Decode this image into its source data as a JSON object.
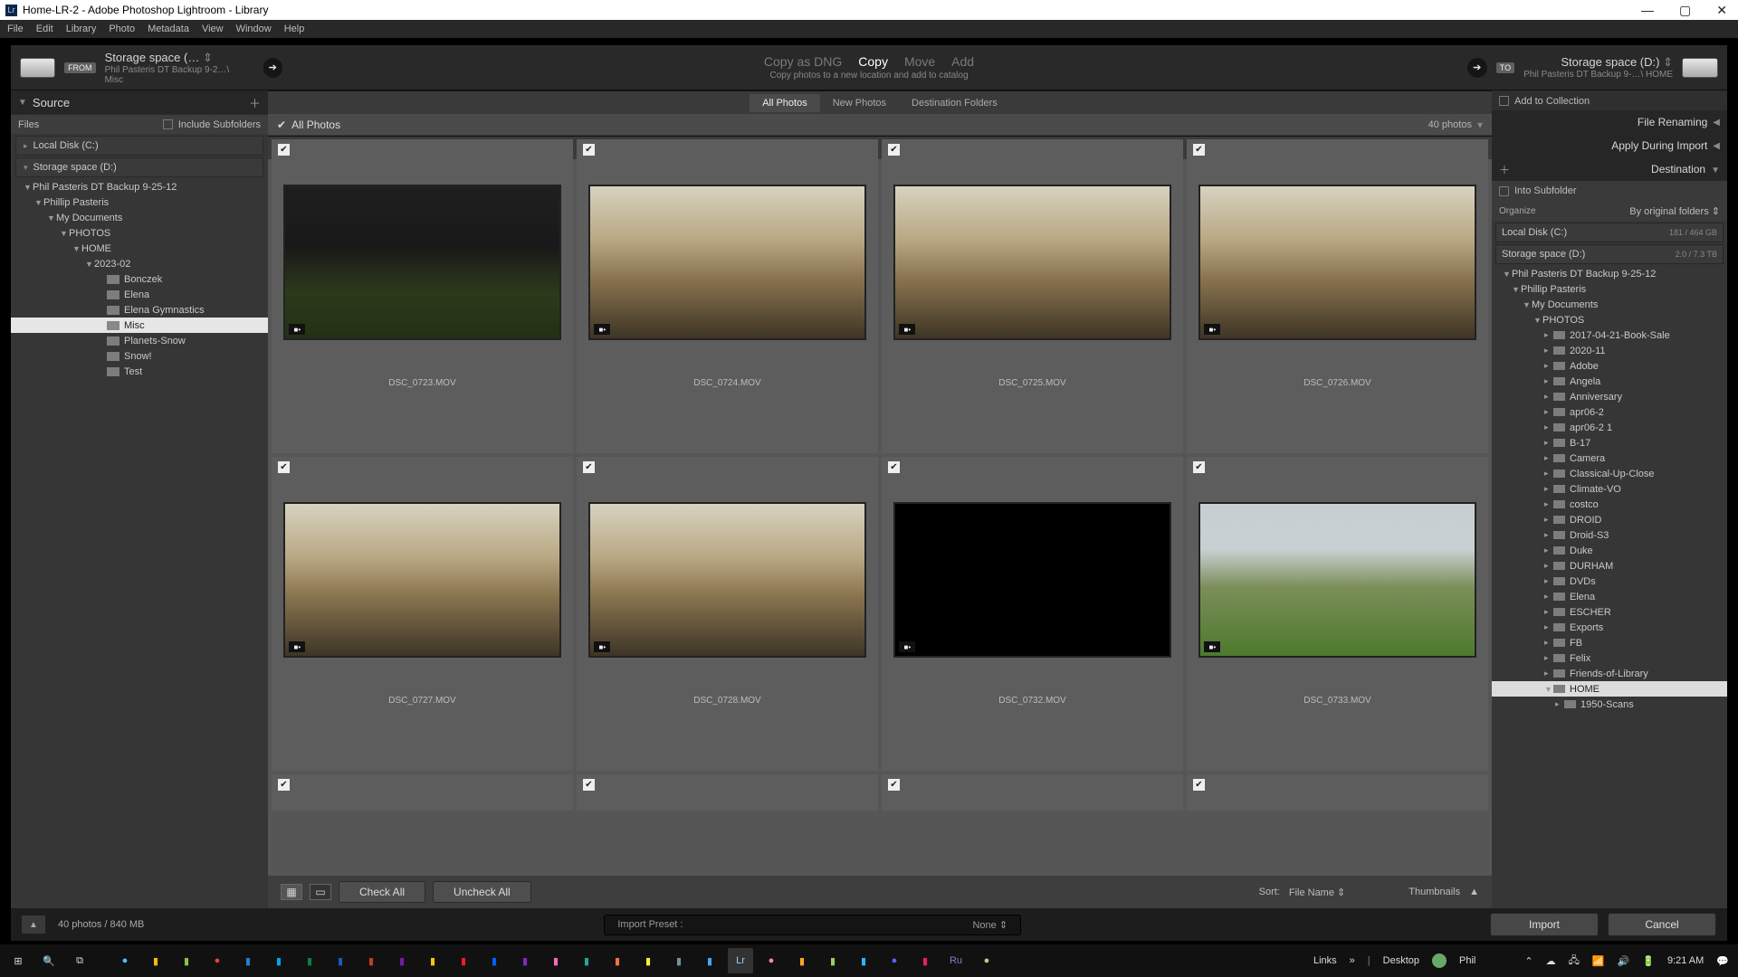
{
  "window": {
    "title": "Home-LR-2 - Adobe Photoshop Lightroom - Library"
  },
  "menu": [
    "File",
    "Edit",
    "Library",
    "Photo",
    "Metadata",
    "View",
    "Window",
    "Help"
  ],
  "import_top": {
    "from_badge": "FROM",
    "from_title": "Storage space (…",
    "from_path": "Phil Pasteris DT Backup 9-2…\\ Misc",
    "modes": {
      "copy_dng": "Copy as DNG",
      "copy": "Copy",
      "move": "Move",
      "add": "Add"
    },
    "modes_sub": "Copy photos to a new location and add to catalog",
    "to_badge": "TO",
    "to_title": "Storage space (D:)",
    "to_path": "Phil Pasteris DT Backup 9-…\\ HOME",
    "add_to_collection": "Add to Collection"
  },
  "view_tabs": {
    "all": "All Photos",
    "new": "New Photos",
    "dest": "Destination Folders"
  },
  "left": {
    "header": "Source",
    "files_label": "Files",
    "include_sub": "Include Subfolders",
    "vol1": "Local Disk (C:)",
    "vol2": "Storage space (D:)",
    "tree": [
      {
        "lvl": 0,
        "exp": "▼",
        "label": "Phil Pasteris DT Backup 9-25-12"
      },
      {
        "lvl": 1,
        "exp": "▼",
        "label": "Phillip Pasteris"
      },
      {
        "lvl": 2,
        "exp": "▼",
        "label": "My Documents"
      },
      {
        "lvl": 3,
        "exp": "▼",
        "label": "PHOTOS"
      },
      {
        "lvl": 4,
        "exp": "▼",
        "label": "HOME"
      },
      {
        "lvl": 5,
        "exp": "▼",
        "label": "2023-02"
      },
      {
        "lvl": 6,
        "exp": "",
        "label": "Bonczek",
        "folder": true
      },
      {
        "lvl": 6,
        "exp": "",
        "label": "Elena",
        "folder": true
      },
      {
        "lvl": 6,
        "exp": "",
        "label": "Elena Gymnastics",
        "folder": true
      },
      {
        "lvl": 6,
        "exp": "",
        "label": "Misc",
        "folder": true,
        "sel": true
      },
      {
        "lvl": 6,
        "exp": "",
        "label": "Planets-Snow",
        "folder": true
      },
      {
        "lvl": 6,
        "exp": "",
        "label": "Snow!",
        "folder": true
      },
      {
        "lvl": 6,
        "exp": "",
        "label": "Test",
        "folder": true
      }
    ]
  },
  "grid": {
    "header_check": true,
    "header_label": "All Photos",
    "count": "40 photos",
    "items": [
      {
        "name": "DSC_0723.MOV",
        "type": "porch"
      },
      {
        "name": "DSC_0724.MOV",
        "type": "office"
      },
      {
        "name": "DSC_0725.MOV",
        "type": "office"
      },
      {
        "name": "DSC_0726.MOV",
        "type": "office"
      },
      {
        "name": "DSC_0727.MOV",
        "type": "office"
      },
      {
        "name": "DSC_0728.MOV",
        "type": "office"
      },
      {
        "name": "DSC_0732.MOV",
        "type": "black"
      },
      {
        "name": "DSC_0733.MOV",
        "type": "yard"
      },
      {
        "name": "",
        "type": "none"
      },
      {
        "name": "",
        "type": "none"
      },
      {
        "name": "",
        "type": "none"
      },
      {
        "name": "",
        "type": "none"
      }
    ],
    "toolbar": {
      "check_all": "Check All",
      "uncheck_all": "Uncheck All",
      "sort_label": "Sort:",
      "sort_value": "File Name",
      "thumbs_label": "Thumbnails"
    }
  },
  "right": {
    "renaming": "File Renaming",
    "apply": "Apply During Import",
    "dest": "Destination",
    "into_sub": "Into Subfolder",
    "organize_label": "Organize",
    "organize_value": "By original folders",
    "vol1": {
      "name": "Local Disk (C:)",
      "quota": "181 / 464 GB"
    },
    "vol2": {
      "name": "Storage space (D:)",
      "quota": "2.0 / 7.3 TB"
    },
    "tree": [
      {
        "lvl": 0,
        "exp": "▼",
        "label": "Phil Pasteris DT Backup 9-25-12"
      },
      {
        "lvl": 1,
        "exp": "▼",
        "label": "Phillip Pasteris"
      },
      {
        "lvl": 2,
        "exp": "▼",
        "label": "My Documents"
      },
      {
        "lvl": 3,
        "exp": "▼",
        "label": "PHOTOS"
      },
      {
        "lvl": 4,
        "exp": "▸",
        "label": "2017-04-21-Book-Sale",
        "folder": true
      },
      {
        "lvl": 4,
        "exp": "▸",
        "label": "2020-11",
        "folder": true
      },
      {
        "lvl": 4,
        "exp": "▸",
        "label": "Adobe",
        "folder": true
      },
      {
        "lvl": 4,
        "exp": "▸",
        "label": "Angela",
        "folder": true
      },
      {
        "lvl": 4,
        "exp": "▸",
        "label": "Anniversary",
        "folder": true
      },
      {
        "lvl": 4,
        "exp": "▸",
        "label": "apr06-2",
        "folder": true
      },
      {
        "lvl": 4,
        "exp": "▸",
        "label": "apr06-2 1",
        "folder": true
      },
      {
        "lvl": 4,
        "exp": "▸",
        "label": "B-17",
        "folder": true
      },
      {
        "lvl": 4,
        "exp": "▸",
        "label": "Camera",
        "folder": true
      },
      {
        "lvl": 4,
        "exp": "▸",
        "label": "Classical-Up-Close",
        "folder": true
      },
      {
        "lvl": 4,
        "exp": "▸",
        "label": "Climate-VO",
        "folder": true
      },
      {
        "lvl": 4,
        "exp": "▸",
        "label": "costco",
        "folder": true
      },
      {
        "lvl": 4,
        "exp": "▸",
        "label": "DROID",
        "folder": true
      },
      {
        "lvl": 4,
        "exp": "▸",
        "label": "Droid-S3",
        "folder": true
      },
      {
        "lvl": 4,
        "exp": "▸",
        "label": "Duke",
        "folder": true
      },
      {
        "lvl": 4,
        "exp": "▸",
        "label": "DURHAM",
        "folder": true
      },
      {
        "lvl": 4,
        "exp": "▸",
        "label": "DVDs",
        "folder": true
      },
      {
        "lvl": 4,
        "exp": "▸",
        "label": "Elena",
        "folder": true
      },
      {
        "lvl": 4,
        "exp": "▸",
        "label": "ESCHER",
        "folder": true
      },
      {
        "lvl": 4,
        "exp": "▸",
        "label": "Exports",
        "folder": true
      },
      {
        "lvl": 4,
        "exp": "▸",
        "label": "FB",
        "folder": true
      },
      {
        "lvl": 4,
        "exp": "▸",
        "label": "Felix",
        "folder": true
      },
      {
        "lvl": 4,
        "exp": "▸",
        "label": "Friends-of-Library",
        "folder": true
      },
      {
        "lvl": 4,
        "exp": "▼",
        "label": "HOME",
        "folder": true,
        "sel": true
      },
      {
        "lvl": 5,
        "exp": "▸",
        "label": "1950-Scans",
        "folder": true
      }
    ]
  },
  "footer": {
    "stats": "40 photos / 840 MB",
    "preset_label": "Import Preset :",
    "preset_value": "None ⇕",
    "import": "Import",
    "cancel": "Cancel"
  },
  "taskbar": {
    "links": "Links",
    "desktop": "Desktop",
    "user": "Phil",
    "time": "9:21 AM"
  }
}
